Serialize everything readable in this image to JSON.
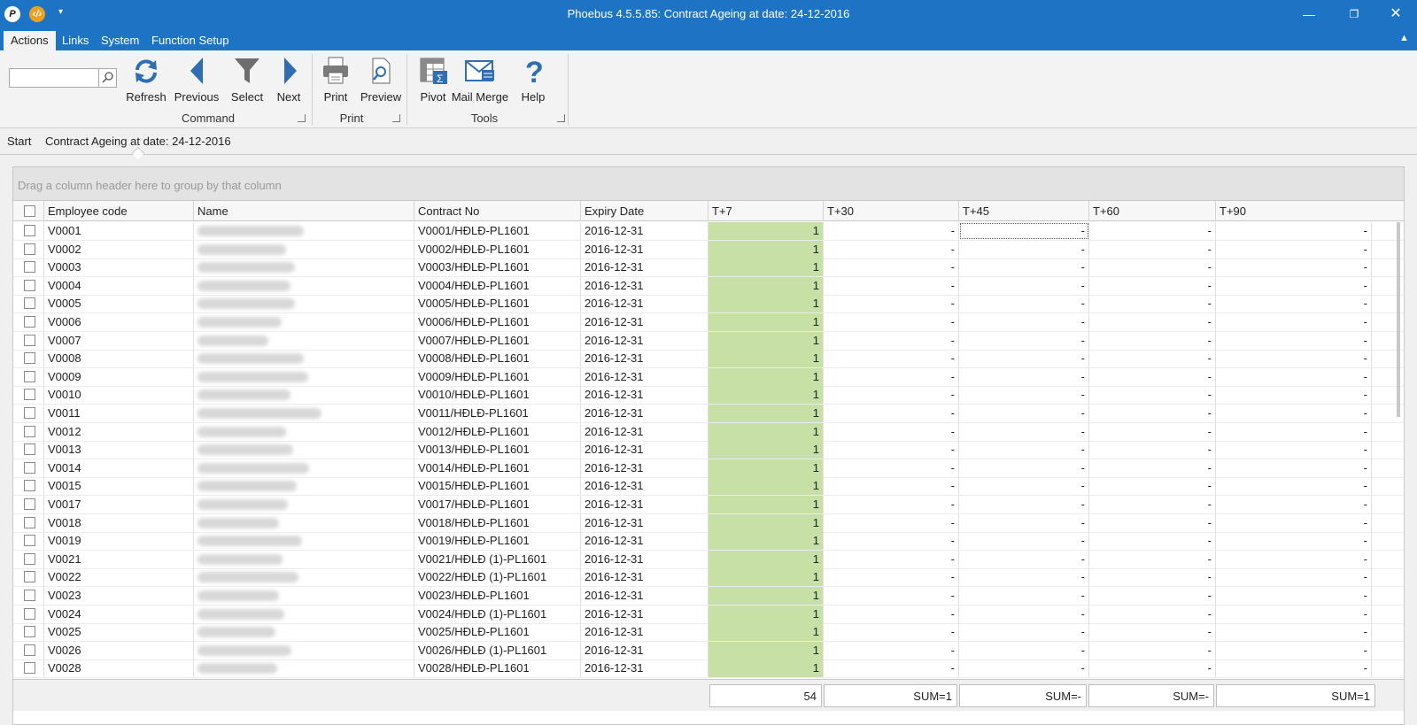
{
  "titlebar": {
    "title": "Phoebus 4.5.5.85: Contract Ageing at date: 24-12-2016",
    "minimize": "—",
    "maximize": "❐",
    "close": "✕"
  },
  "menu": {
    "tabs": [
      "Actions",
      "Links",
      "System",
      "Function Setup"
    ],
    "active": "Actions"
  },
  "ribbon": {
    "search_value": "",
    "groups": {
      "command": "Command",
      "print": "Print",
      "tools": "Tools"
    },
    "buttons": {
      "refresh": "Refresh",
      "previous": "Previous",
      "select": "Select",
      "next": "Next",
      "print": "Print",
      "preview": "Preview",
      "pivot": "Pivot",
      "mail_merge": "Mail Merge",
      "help": "Help"
    },
    "icons": {
      "refresh": "refresh-icon",
      "previous": "arrow-left-icon",
      "select": "filter-icon",
      "next": "arrow-right-icon",
      "print": "printer-icon",
      "preview": "preview-icon",
      "pivot": "pivot-table-icon",
      "mail_merge": "mail-merge-icon",
      "help": "help-icon"
    },
    "accent": "#2f6db5"
  },
  "breadcrumb": {
    "start": "Start",
    "current": "Contract Ageing at date: 24-12-2016"
  },
  "grid": {
    "group_hint": "Drag a column header here to group by that column",
    "columns": [
      "Employee code",
      "Name",
      "Contract No",
      "Expiry Date",
      "T+7",
      "T+30",
      "T+45",
      "T+60",
      "T+90"
    ],
    "highlight_color": "#c6e0a6",
    "rows": [
      {
        "code": "V0001",
        "contract": "V0001/HĐLĐ-PL1601",
        "expiry": "2016-12-31",
        "t7": "1",
        "t30": "-",
        "t45": "-",
        "t60": "-",
        "t90": "-"
      },
      {
        "code": "V0002",
        "contract": "V0002/HĐLĐ-PL1601",
        "expiry": "2016-12-31",
        "t7": "1",
        "t30": "-",
        "t45": "-",
        "t60": "-",
        "t90": "-"
      },
      {
        "code": "V0003",
        "contract": "V0003/HĐLĐ-PL1601",
        "expiry": "2016-12-31",
        "t7": "1",
        "t30": "-",
        "t45": "-",
        "t60": "-",
        "t90": "-"
      },
      {
        "code": "V0004",
        "contract": "V0004/HĐLĐ-PL1601",
        "expiry": "2016-12-31",
        "t7": "1",
        "t30": "-",
        "t45": "-",
        "t60": "-",
        "t90": "-"
      },
      {
        "code": "V0005",
        "contract": "V0005/HĐLĐ-PL1601",
        "expiry": "2016-12-31",
        "t7": "1",
        "t30": "-",
        "t45": "-",
        "t60": "-",
        "t90": "-"
      },
      {
        "code": "V0006",
        "contract": "V0006/HĐLĐ-PL1601",
        "expiry": "2016-12-31",
        "t7": "1",
        "t30": "-",
        "t45": "-",
        "t60": "-",
        "t90": "-"
      },
      {
        "code": "V0007",
        "contract": "V0007/HĐLĐ-PL1601",
        "expiry": "2016-12-31",
        "t7": "1",
        "t30": "-",
        "t45": "-",
        "t60": "-",
        "t90": "-"
      },
      {
        "code": "V0008",
        "contract": "V0008/HĐLĐ-PL1601",
        "expiry": "2016-12-31",
        "t7": "1",
        "t30": "-",
        "t45": "-",
        "t60": "-",
        "t90": "-"
      },
      {
        "code": "V0009",
        "contract": "V0009/HĐLĐ-PL1601",
        "expiry": "2016-12-31",
        "t7": "1",
        "t30": "-",
        "t45": "-",
        "t60": "-",
        "t90": "-"
      },
      {
        "code": "V0010",
        "contract": "V0010/HĐLĐ-PL1601",
        "expiry": "2016-12-31",
        "t7": "1",
        "t30": "-",
        "t45": "-",
        "t60": "-",
        "t90": "-"
      },
      {
        "code": "V0011",
        "contract": "V0011/HĐLĐ-PL1601",
        "expiry": "2016-12-31",
        "t7": "1",
        "t30": "-",
        "t45": "-",
        "t60": "-",
        "t90": "-"
      },
      {
        "code": "V0012",
        "contract": "V0012/HĐLĐ-PL1601",
        "expiry": "2016-12-31",
        "t7": "1",
        "t30": "-",
        "t45": "-",
        "t60": "-",
        "t90": "-"
      },
      {
        "code": "V0013",
        "contract": "V0013/HĐLĐ-PL1601",
        "expiry": "2016-12-31",
        "t7": "1",
        "t30": "-",
        "t45": "-",
        "t60": "-",
        "t90": "-"
      },
      {
        "code": "V0014",
        "contract": "V0014/HĐLĐ-PL1601",
        "expiry": "2016-12-31",
        "t7": "1",
        "t30": "-",
        "t45": "-",
        "t60": "-",
        "t90": "-"
      },
      {
        "code": "V0015",
        "contract": "V0015/HĐLĐ-PL1601",
        "expiry": "2016-12-31",
        "t7": "1",
        "t30": "-",
        "t45": "-",
        "t60": "-",
        "t90": "-"
      },
      {
        "code": "V0017",
        "contract": "V0017/HĐLĐ-PL1601",
        "expiry": "2016-12-31",
        "t7": "1",
        "t30": "-",
        "t45": "-",
        "t60": "-",
        "t90": "-"
      },
      {
        "code": "V0018",
        "contract": "V0018/HĐLĐ-PL1601",
        "expiry": "2016-12-31",
        "t7": "1",
        "t30": "-",
        "t45": "-",
        "t60": "-",
        "t90": "-"
      },
      {
        "code": "V0019",
        "contract": "V0019/HĐLĐ-PL1601",
        "expiry": "2016-12-31",
        "t7": "1",
        "t30": "-",
        "t45": "-",
        "t60": "-",
        "t90": "-"
      },
      {
        "code": "V0021",
        "contract": "V0021/HĐLĐ (1)-PL1601",
        "expiry": "2016-12-31",
        "t7": "1",
        "t30": "-",
        "t45": "-",
        "t60": "-",
        "t90": "-"
      },
      {
        "code": "V0022",
        "contract": "V0022/HĐLĐ (1)-PL1601",
        "expiry": "2016-12-31",
        "t7": "1",
        "t30": "-",
        "t45": "-",
        "t60": "-",
        "t90": "-"
      },
      {
        "code": "V0023",
        "contract": "V0023/HĐLĐ-PL1601",
        "expiry": "2016-12-31",
        "t7": "1",
        "t30": "-",
        "t45": "-",
        "t60": "-",
        "t90": "-"
      },
      {
        "code": "V0024",
        "contract": "V0024/HĐLĐ (1)-PL1601",
        "expiry": "2016-12-31",
        "t7": "1",
        "t30": "-",
        "t45": "-",
        "t60": "-",
        "t90": "-"
      },
      {
        "code": "V0025",
        "contract": "V0025/HĐLĐ-PL1601",
        "expiry": "2016-12-31",
        "t7": "1",
        "t30": "-",
        "t45": "-",
        "t60": "-",
        "t90": "-"
      },
      {
        "code": "V0026",
        "contract": "V0026/HĐLĐ (1)-PL1601",
        "expiry": "2016-12-31",
        "t7": "1",
        "t30": "-",
        "t45": "-",
        "t60": "-",
        "t90": "-"
      },
      {
        "code": "V0028",
        "contract": "V0028/HĐLĐ-PL1601",
        "expiry": "2016-12-31",
        "t7": "1",
        "t30": "-",
        "t45": "-",
        "t60": "-",
        "t90": "-"
      }
    ],
    "footer": {
      "t7": "54",
      "t30": "SUM=1",
      "t45": "SUM=-",
      "t60": "SUM=-",
      "t90": "SUM=1"
    }
  }
}
